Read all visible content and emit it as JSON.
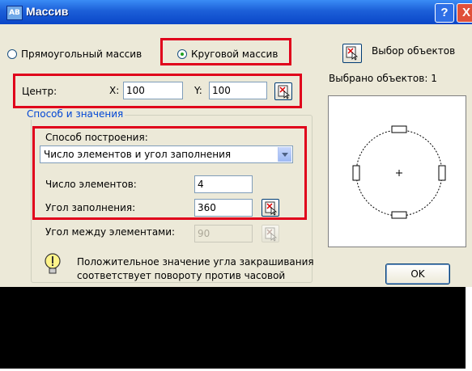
{
  "window": {
    "title": "Массив",
    "app_icon_text": "AB",
    "help_label": "?",
    "close_label": "X"
  },
  "array_type": {
    "rectangular_label": "Прямоугольный массив",
    "polar_label": "Круговой массив",
    "selected": "polar"
  },
  "selection": {
    "select_objects_label": "Выбор объектов",
    "selected_count_text": "Выбрано объектов: 1"
  },
  "center": {
    "label": "Центр:",
    "x_label": "X:",
    "x_value": "100",
    "y_label": "Y:",
    "y_value": "100"
  },
  "method_group": {
    "legend": "Способ и значения",
    "method_label": "Способ построения:",
    "method_value": "Число элементов и угол заполнения",
    "count_label": "Число элементов:",
    "count_value": "4",
    "fill_angle_label": "Угол заполнения:",
    "fill_angle_value": "360",
    "between_label": "Угол между элементами:",
    "between_value": "90"
  },
  "hint": {
    "line1": "Положительное значение угла закрашивания",
    "line2": "соответствует повороту против часовой"
  },
  "ok_label": "OK",
  "colors": {
    "title_bar": "#0a46c8",
    "highlight_box": "#e0001b",
    "group_legend": "#0046d5",
    "dialog_bg": "#ece9d8"
  },
  "icons": {
    "pick_button": "pick-point-icon",
    "hint": "lightbulb-icon"
  }
}
